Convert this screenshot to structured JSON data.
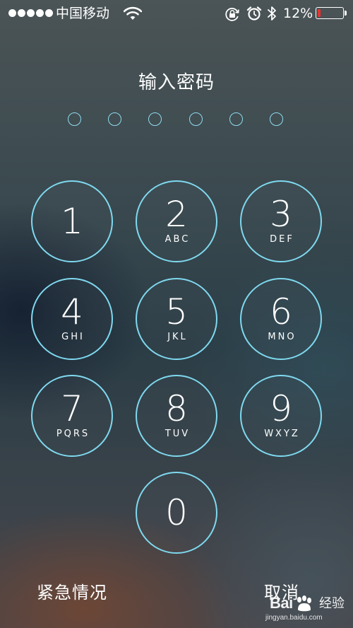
{
  "status_bar": {
    "signal_bars": 5,
    "carrier": "中国移动",
    "battery_percent": "12%",
    "battery_level": 0.12,
    "battery_color": "#e8332e",
    "icons": [
      "wifi-icon",
      "lock-rotation-icon",
      "alarm-icon",
      "bluetooth-icon",
      "battery-icon"
    ]
  },
  "prompt": {
    "title": "输入密码"
  },
  "passcode": {
    "length": 6,
    "entered": 0
  },
  "keypad": {
    "ring_color": "#7fd9ef",
    "keys": [
      {
        "digit": "1",
        "letters": ""
      },
      {
        "digit": "2",
        "letters": "ABC"
      },
      {
        "digit": "3",
        "letters": "DEF"
      },
      {
        "digit": "4",
        "letters": "GHI"
      },
      {
        "digit": "5",
        "letters": "JKL"
      },
      {
        "digit": "6",
        "letters": "MNO"
      },
      {
        "digit": "7",
        "letters": "PQRS"
      },
      {
        "digit": "8",
        "letters": "TUV"
      },
      {
        "digit": "9",
        "letters": "WXYZ"
      },
      {
        "digit": "0",
        "letters": ""
      }
    ]
  },
  "actions": {
    "emergency": "紧急情况",
    "cancel": "取消"
  },
  "watermark": {
    "brand": "Bai",
    "label": "经验",
    "url": "jingyan.baidu.com"
  }
}
